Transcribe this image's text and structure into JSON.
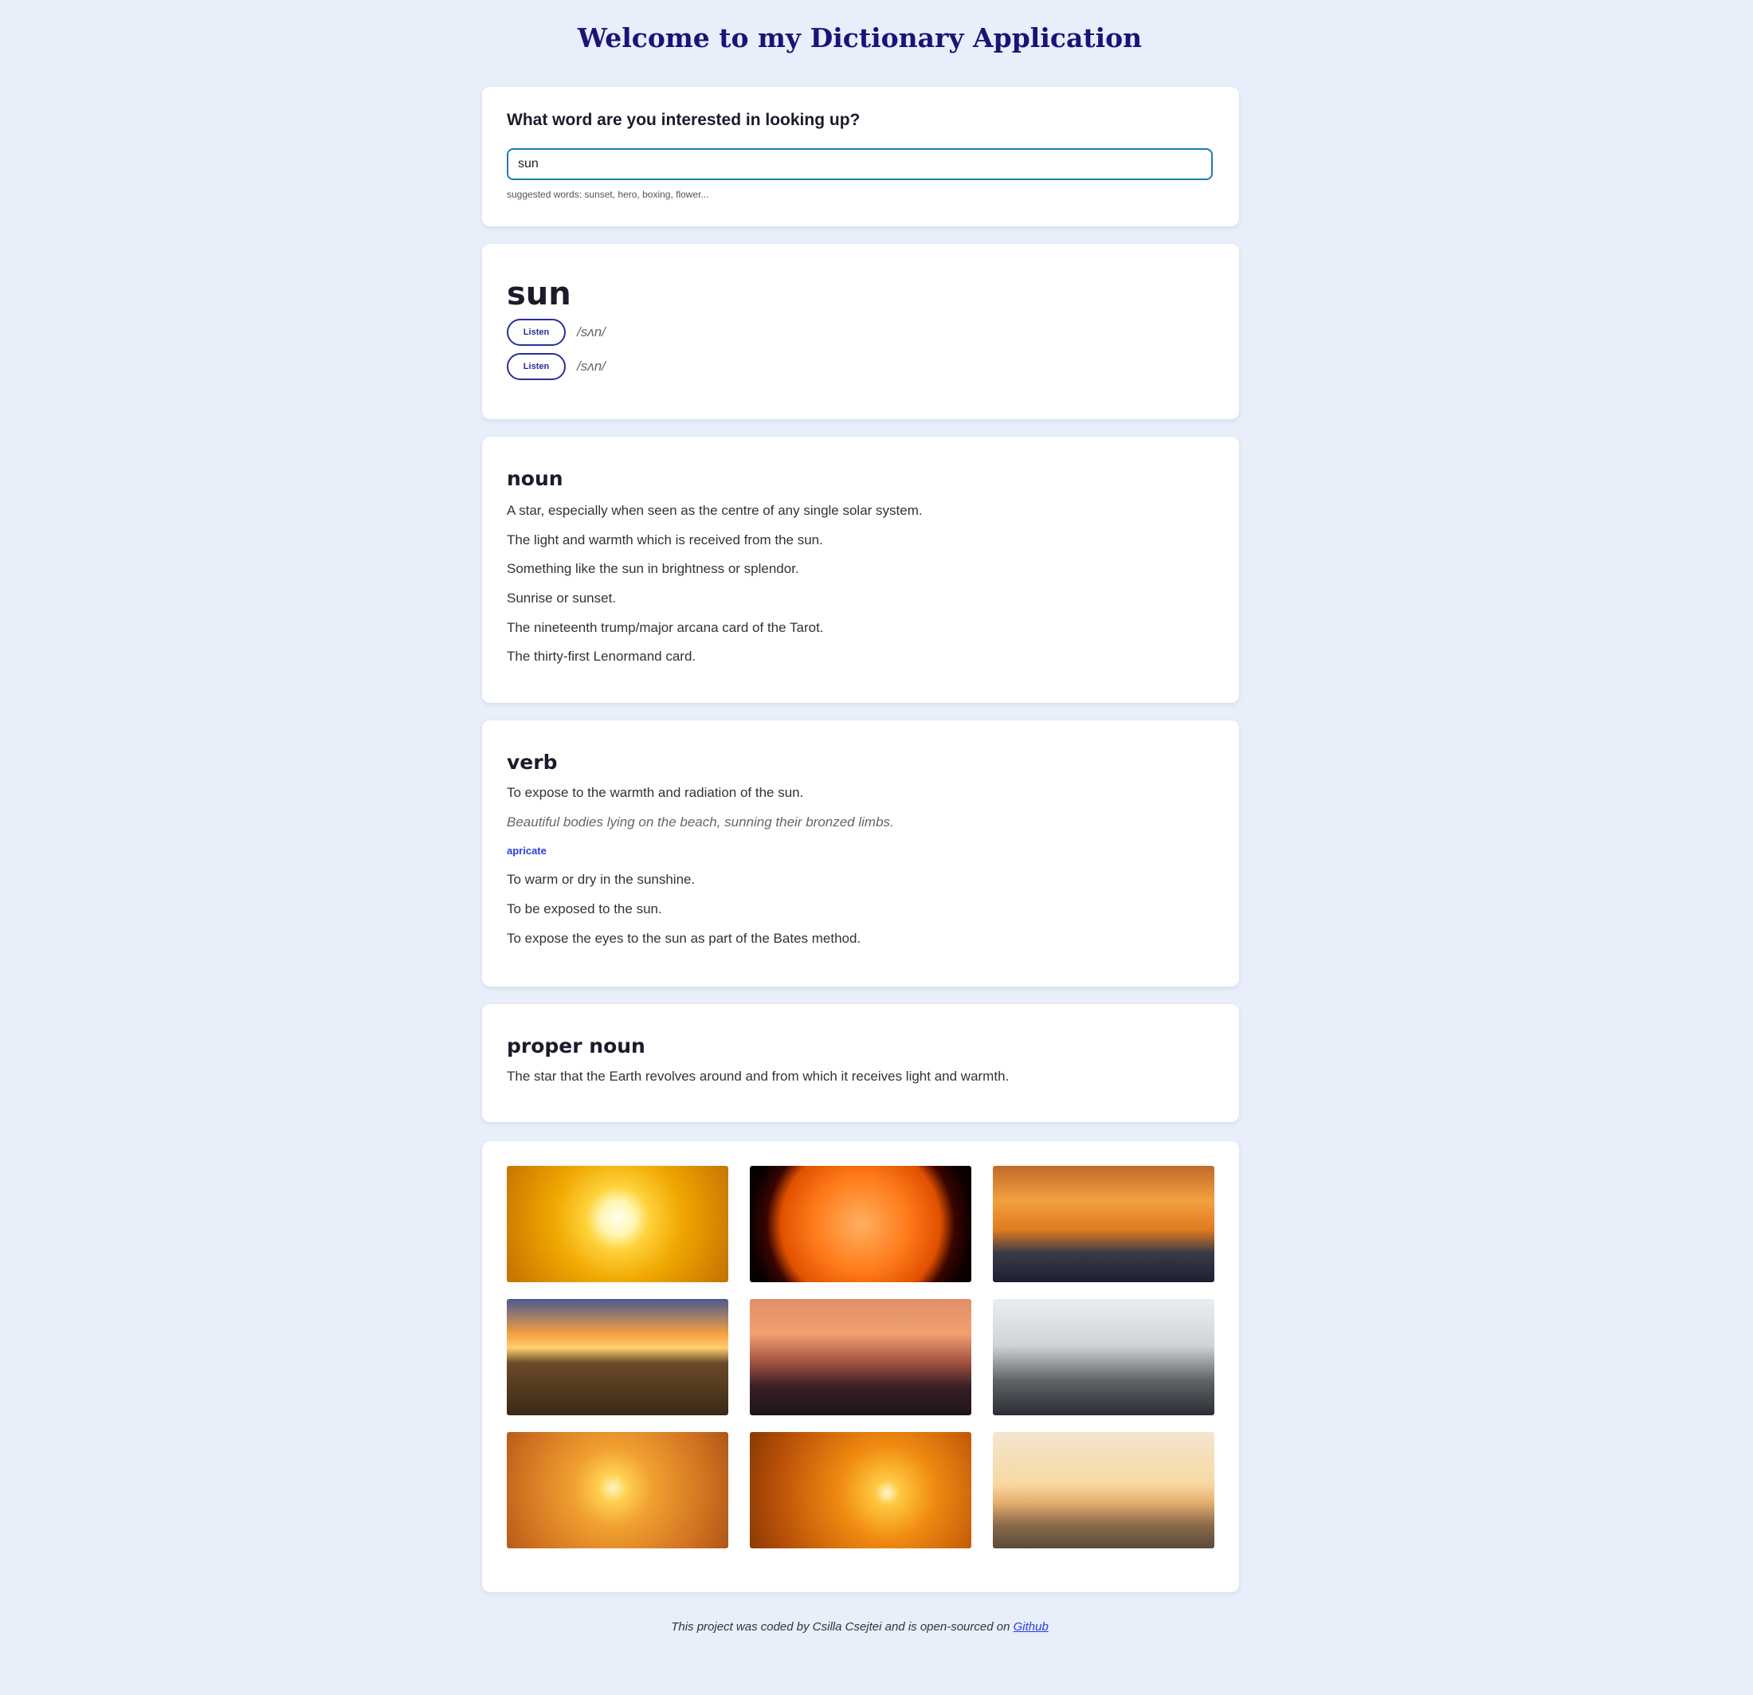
{
  "header": {
    "title": "Welcome to my Dictionary Application"
  },
  "search": {
    "label": "What word are you interested in looking up?",
    "value": "sun",
    "hint": "suggested words: sunset, hero, boxing, flower..."
  },
  "word": {
    "text": "sun",
    "phonetics": [
      {
        "button_label": "Listen",
        "text": "/sʌn/"
      },
      {
        "button_label": "Listen",
        "text": "/sʌn/"
      }
    ]
  },
  "meanings": {
    "noun": {
      "part_of_speech": "noun",
      "definitions": [
        "A star, especially when seen as the centre of any single solar system.",
        "The light and warmth which is received from the sun.",
        "Something like the sun in brightness or splendor.",
        "Sunrise or sunset.",
        "The nineteenth trump/major arcana card of the Tarot.",
        "The thirty-first Lenormand card."
      ]
    },
    "verb": {
      "part_of_speech": "verb",
      "definition_1": "To expose to the warmth and radiation of the sun.",
      "example_1": "Beautiful bodies lying on the beach, sunning their bronzed limbs.",
      "synonym_1": "apricate",
      "definition_2": "To warm or dry in the sunshine.",
      "definition_3": "To be exposed to the sun.",
      "definition_4": "To expose the eyes to the sun as part of the Bates method."
    },
    "proper_noun": {
      "part_of_speech": "proper noun",
      "definitions": [
        "The star that the Earth revolves around and from which it receives light and warmth."
      ]
    }
  },
  "footer": {
    "text": "This project was coded by Csilla Csejtei and is open-sourced on ",
    "link": "Github"
  },
  "colors": {
    "background": "#e8eefa",
    "title": "#1a1378",
    "accent": "#2a2f9a",
    "input_border": "#1f7ab5",
    "link": "#2b3dd8"
  }
}
